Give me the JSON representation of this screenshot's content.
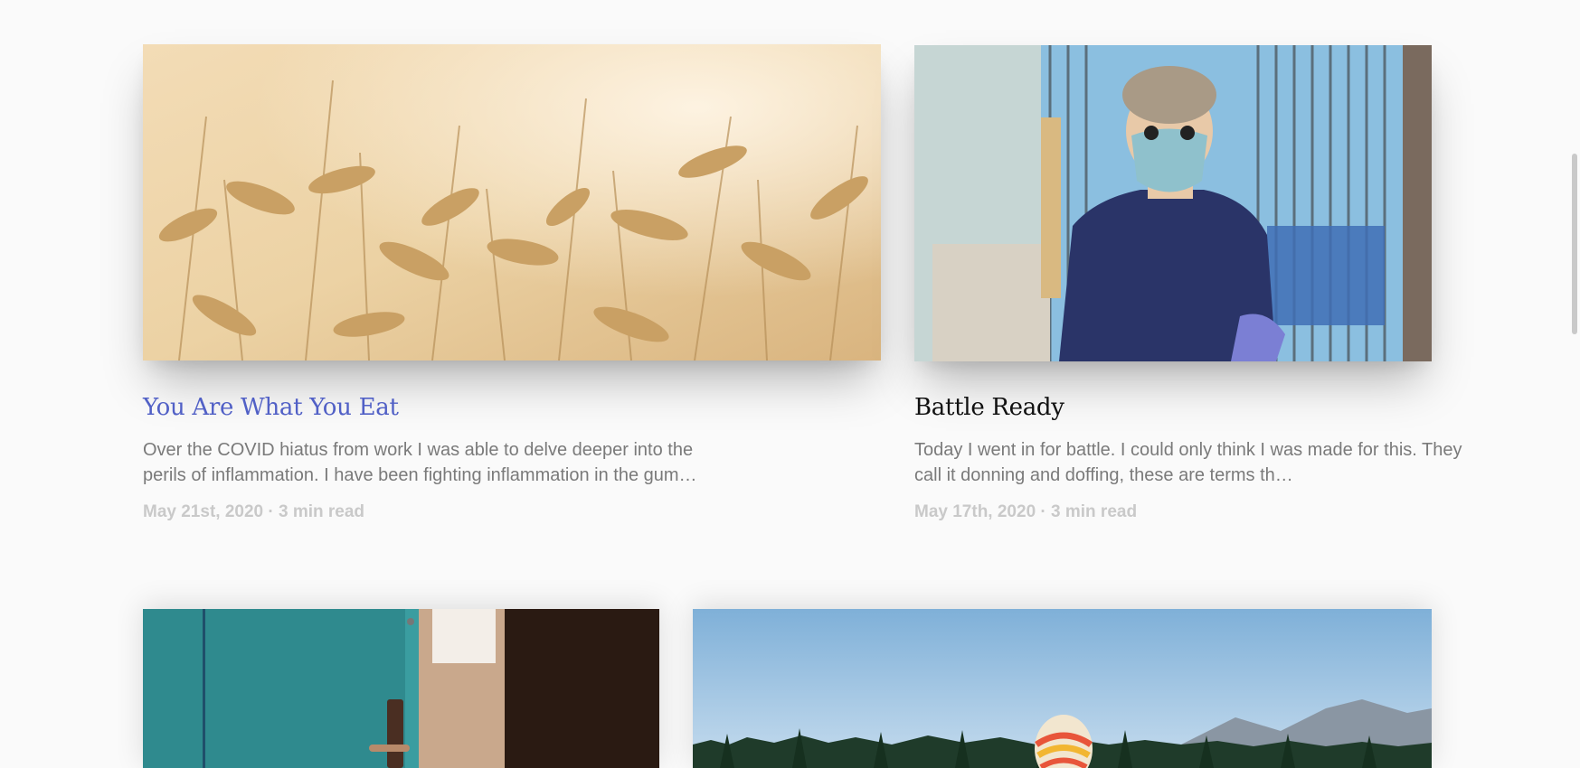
{
  "articles": [
    {
      "title": "You Are What You Eat",
      "excerpt": "Over the COVID hiatus from work I was able to delve deeper into the perils of inflammation. I have been fighting inflammation in the gum…",
      "date": "May 21st, 2020",
      "separator": "·",
      "read_time": "3 min read",
      "image": "wheat-field-photo",
      "title_color": "#5160c6"
    },
    {
      "title": "Battle Ready",
      "excerpt": "Today I went in for battle. I could only think I was made for this. They call it donning and doffing, these are terms th…",
      "date": "May 17th, 2020",
      "separator": "·",
      "read_time": "3 min read",
      "image": "dental-clinician-in-ppe-photo",
      "title_color": "#111111"
    },
    {
      "image": "teal-door-photo"
    },
    {
      "image": "hot-air-balloon-landscape-photo"
    }
  ],
  "colors": {
    "background": "#fafafa",
    "excerpt_text": "#7a7a7a",
    "meta_text": "#c9c9c9"
  }
}
